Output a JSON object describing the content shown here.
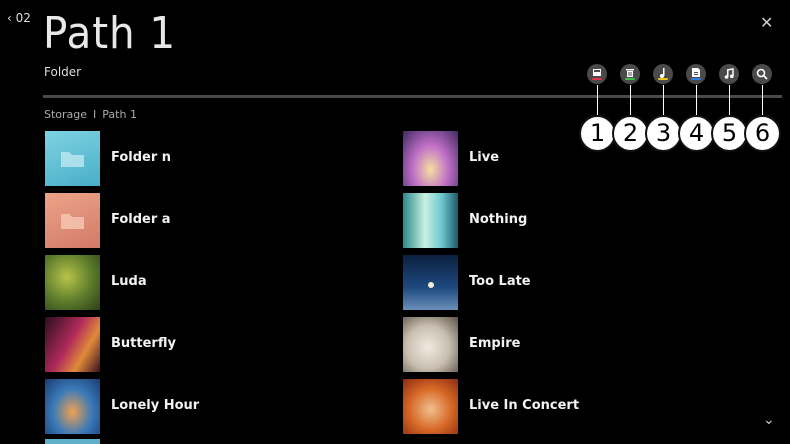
{
  "header": {
    "back_label": "02",
    "title": "Path 1",
    "subtitle": "Folder",
    "close_glyph": "✕"
  },
  "breadcrumb": {
    "root": "Storage",
    "separator": "I",
    "current": "Path 1"
  },
  "toolbar": {
    "buttons": [
      {
        "icon": "copy-icon",
        "bar_color": "#e0334a"
      },
      {
        "icon": "delete-icon",
        "bar_color": "#3fbf4a"
      },
      {
        "icon": "playlist-icon",
        "bar_color": "#e6c51e"
      },
      {
        "icon": "file-info-icon",
        "bar_color": "#2f7fe0"
      },
      {
        "icon": "music-icon",
        "bar_color": ""
      },
      {
        "icon": "search-icon",
        "bar_color": ""
      }
    ],
    "callouts": [
      "1",
      "2",
      "3",
      "4",
      "5",
      "6"
    ]
  },
  "items": [
    {
      "label": "Folder n",
      "kind": "folder"
    },
    {
      "label": "Live",
      "kind": "image"
    },
    {
      "label": "Folder a",
      "kind": "folder"
    },
    {
      "label": "Nothing",
      "kind": "image"
    },
    {
      "label": "Luda",
      "kind": "image"
    },
    {
      "label": "Too Late",
      "kind": "image"
    },
    {
      "label": "Butterfly",
      "kind": "image"
    },
    {
      "label": "Empire",
      "kind": "image"
    },
    {
      "label": "Lonely Hour",
      "kind": "image"
    },
    {
      "label": "Live In Concert",
      "kind": "image"
    }
  ],
  "colors": {
    "background": "#000000",
    "folder_n_tile": "#5cc0d6",
    "folder_a_tile": "#e0907a",
    "button_bg": "#4a4a4a"
  },
  "scroll_glyph": "⌄"
}
